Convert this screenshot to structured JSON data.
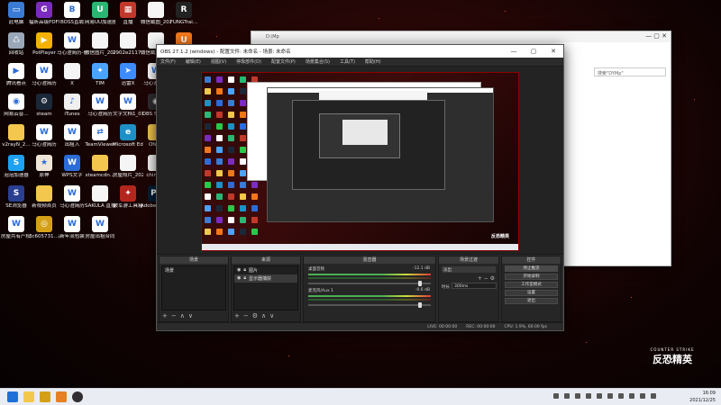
{
  "desktop": {
    "icons": [
      {
        "label": "此电脑",
        "icon": "computer-icon",
        "color": "#3a7bd5",
        "glyph": "▭"
      },
      {
        "label": "福昕高级PDF编辑器",
        "icon": "pdf-editor-icon",
        "color": "#7b2cbf",
        "glyph": "G"
      },
      {
        "label": "BOSS直聘",
        "icon": "boss-icon",
        "color": "#ffffff",
        "glyph": "B"
      },
      {
        "label": "网易UU加速器",
        "icon": "uu-icon",
        "color": "#2bb673",
        "glyph": "U"
      },
      {
        "label": "直播",
        "icon": "archive-icon",
        "color": "#c0392b",
        "glyph": "▦"
      },
      {
        "label": "微信截图_2021120…",
        "icon": "file-icon",
        "color": "#f5f5f5",
        "glyph": ""
      },
      {
        "label": "FUNGTrai…",
        "icon": "fungtrai-icon",
        "color": "#222222",
        "glyph": "R"
      },
      {
        "label": "回收站",
        "icon": "recycle-bin-icon",
        "color": "#9aa7b8",
        "glyph": "♺"
      },
      {
        "label": "PotPlayer",
        "icon": "potplayer-icon",
        "color": "#f5b301",
        "glyph": "▶"
      },
      {
        "label": "马心澄简历-创意设计…",
        "icon": "doc-icon",
        "color": "#ffffff",
        "glyph": "W"
      },
      {
        "label": "微信图片_2021110…",
        "icon": "file-icon",
        "color": "#f5f5f5",
        "glyph": ""
      },
      {
        "label": "2902e2117…副本",
        "icon": "file-icon",
        "color": "#f5f5f5",
        "glyph": ""
      },
      {
        "label": "微信截图_20211…",
        "icon": "file-icon",
        "color": "#f5f5f5",
        "glyph": ""
      },
      {
        "label": "UC浏览器",
        "icon": "uc-browser-icon",
        "color": "#f2771a",
        "glyph": "U"
      },
      {
        "label": "腾讯看点",
        "icon": "tencent-icon",
        "color": "#ffffff",
        "glyph": "▶"
      },
      {
        "label": "马心澄简历",
        "icon": "doc-icon",
        "color": "#ffffff",
        "glyph": "W"
      },
      {
        "label": "X",
        "icon": "file-icon",
        "color": "#f5f5f5",
        "glyph": ""
      },
      {
        "label": "TIM",
        "icon": "tim-icon",
        "color": "#4aa3ff",
        "glyph": "✦"
      },
      {
        "label": "迅雷X",
        "icon": "xunlei-icon",
        "color": "#3d8bff",
        "glyph": "➤"
      },
      {
        "label": "马心澄简历",
        "icon": "doc-icon",
        "color": "#ffffff",
        "glyph": "W"
      },
      {
        "label": "文字文档1",
        "icon": "folder-icon",
        "color": "#f3c74d",
        "glyph": ""
      },
      {
        "label": "网易云音…",
        "icon": "music-icon",
        "color": "#ffffff",
        "glyph": "◉"
      },
      {
        "label": "steam",
        "icon": "steam-icon",
        "color": "#1b2838",
        "glyph": "⚙"
      },
      {
        "label": "iTunes",
        "icon": "itunes-icon",
        "color": "#f0f0f0",
        "glyph": "♪"
      },
      {
        "label": "马心澄简历",
        "icon": "doc-icon",
        "color": "#ffffff",
        "glyph": "W"
      },
      {
        "label": "文字文档1_01",
        "icon": "doc-icon",
        "color": "#ffffff",
        "glyph": "W"
      },
      {
        "label": "OBS Studio",
        "icon": "obs-icon",
        "color": "#302e31",
        "glyph": "◉"
      },
      {
        "label": "微信",
        "icon": "wechat-icon",
        "color": "#2ac84a",
        "glyph": "◍"
      },
      {
        "label": "v2rayN_2…",
        "icon": "folder-icon",
        "color": "#f3c74d",
        "glyph": ""
      },
      {
        "label": "马心澄简历",
        "icon": "doc-icon",
        "color": "#ffffff",
        "glyph": "W"
      },
      {
        "label": "出租入",
        "icon": "doc-icon",
        "color": "#ffffff",
        "glyph": "W"
      },
      {
        "label": "TeamViewer",
        "icon": "teamviewer-icon",
        "color": "#ffffff",
        "glyph": "⇄"
      },
      {
        "label": "Microsoft Edge",
        "icon": "edge-icon",
        "color": "#1e90c8",
        "glyph": "e"
      },
      {
        "label": "Ofelia",
        "icon": "folder-icon",
        "color": "#f3c74d",
        "glyph": ""
      },
      {
        "label": "房屋共有产权人同意…",
        "icon": "doc-icon",
        "color": "#ffffff",
        "glyph": "W"
      },
      {
        "label": "泡泡加速器",
        "icon": "accelerator-icon",
        "color": "#1da1f2",
        "glyph": "S"
      },
      {
        "label": "原神",
        "icon": "genshin-icon",
        "color": "#f0e6d8",
        "glyph": "★"
      },
      {
        "label": "WPS文字",
        "icon": "wps-icon",
        "color": "#2b6cd8",
        "glyph": "W"
      },
      {
        "label": "steamcdn…",
        "icon": "folder-icon",
        "color": "#f3c74d",
        "glyph": ""
      },
      {
        "label": "房屋照片_2021102…",
        "icon": "file-icon",
        "color": "#f5f5f5",
        "glyph": ""
      },
      {
        "label": "chinese",
        "icon": "file-icon",
        "color": "#f5f5f5",
        "glyph": ""
      },
      {
        "label": "微信截图_2021-11…",
        "icon": "doc-icon",
        "color": "#ffffff",
        "glyph": "W"
      },
      {
        "label": "SE浏览器",
        "icon": "se-icon",
        "color": "#2a3f8f",
        "glyph": "S"
      },
      {
        "label": "新视频首页",
        "icon": "folder-icon",
        "color": "#f3c74d",
        "glyph": ""
      },
      {
        "label": "马心澄简历",
        "icon": "doc-icon",
        "color": "#ffffff",
        "glyph": "W"
      },
      {
        "label": "SAKULA 直播组",
        "icon": "file-icon",
        "color": "#f5f5f5",
        "glyph": ""
      },
      {
        "label": "破军游工具箱",
        "icon": "tool-icon",
        "color": "#b3261e",
        "glyph": "✦"
      },
      {
        "label": "Adobe Photosh…",
        "icon": "photoshop-icon",
        "color": "#001e36",
        "glyph": "Ps"
      },
      {
        "label": "马心澄简历",
        "icon": "doc-icon",
        "color": "#ffffff",
        "glyph": "W"
      },
      {
        "label": "房屋共有产权人同意…",
        "icon": "doc-icon",
        "color": "#ffffff",
        "glyph": "W"
      },
      {
        "label": "3c605731…副本",
        "icon": "file-icon",
        "color": "#d4a017",
        "glyph": "◎"
      },
      {
        "label": "新年流包装",
        "icon": "doc-icon",
        "color": "#ffffff",
        "glyph": "W"
      },
      {
        "label": "房屋出租合同",
        "icon": "doc-icon",
        "color": "#ffffff",
        "glyph": "W"
      }
    ]
  },
  "explorer": {
    "title": "D:\\Mp",
    "search_placeholder": "搜索\"DYMp\""
  },
  "obs": {
    "title": "OBS 27.1.2 (windows) - 配置文件: 未命名 - 场景: 未命名",
    "menu": [
      "文件(F)",
      "编辑(E)",
      "视图(V)",
      "停靠部件(D)",
      "配置文件(P)",
      "场景集合(S)",
      "工具(T)",
      "帮助(H)"
    ],
    "preview_logo": "反恐精英",
    "docks": {
      "scenes": {
        "header": "场景",
        "items": [
          "场景"
        ]
      },
      "sources": {
        "header": "来源",
        "items": [
          "图片",
          "显示器捕获"
        ]
      },
      "mixer": {
        "header": "混音器",
        "tracks": [
          {
            "name": "桌面音频",
            "db": "-12.1 dB"
          },
          {
            "name": "麦克风/Aux 1",
            "db": "-0.6 dB"
          }
        ]
      },
      "transitions": {
        "header": "场景过渡",
        "type": "淡出",
        "duration_label": "时长",
        "duration": "300ms"
      },
      "controls": {
        "header": "控件",
        "buttons": [
          "停止推流",
          "开始录制",
          "工作室模式",
          "设置",
          "退出"
        ]
      }
    },
    "status": {
      "live": "LIVE: 00:00:00",
      "rec": "REC: 00:00:00",
      "cpu": "CPU: 1.9%, 60.00 fps"
    }
  },
  "desktop_logo": {
    "line1": "COUNTER STRIKE",
    "line2": "反恐精英"
  },
  "taskbar": {
    "time": "16:09",
    "date": "2021/12/25"
  }
}
